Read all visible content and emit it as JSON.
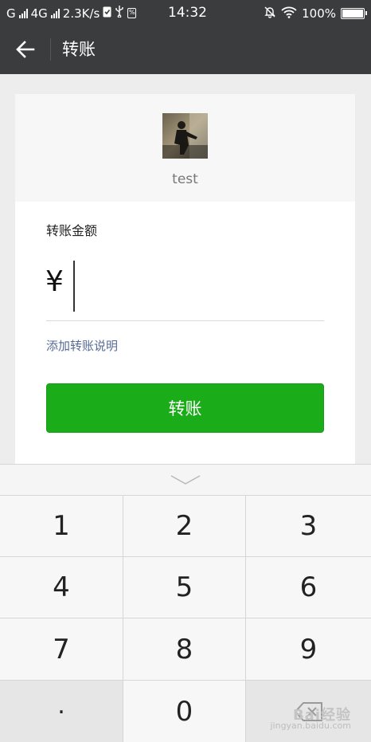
{
  "status_bar": {
    "carrier": "G",
    "network": "4G",
    "speed": "2.3K/s",
    "time": "14:32",
    "battery": "100%",
    "battery_level": 1.0
  },
  "nav": {
    "back_icon": "arrow-left-icon",
    "title": "转账"
  },
  "payee": {
    "name": "test"
  },
  "amount": {
    "label": "转账金额",
    "currency": "¥",
    "value": ""
  },
  "add_note": "添加转账说明",
  "confirm_button": "转账",
  "keypad": {
    "collapse_icon": "chevron-down-icon",
    "keys": [
      "1",
      "2",
      "3",
      "4",
      "5",
      "6",
      "7",
      "8",
      "9",
      ".",
      "0",
      ""
    ]
  },
  "watermark": {
    "logo": "Bai经验",
    "url": "jingyan.baidu.com"
  },
  "colors": {
    "bar": "#3b3c3e",
    "primary_green": "#1aad19",
    "link_blue": "#576b95"
  }
}
